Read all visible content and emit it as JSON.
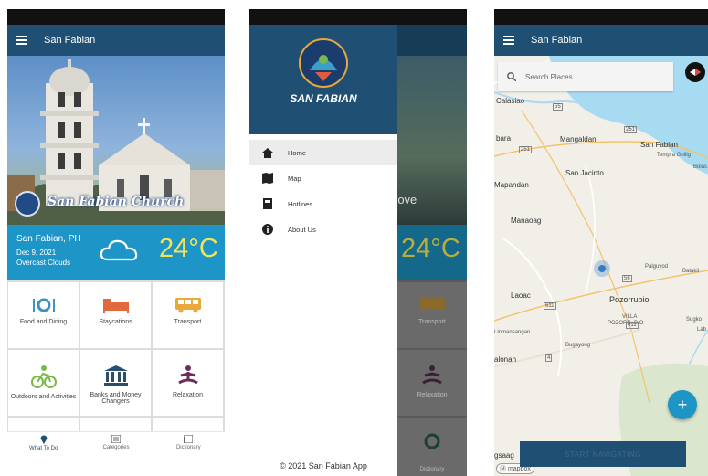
{
  "app": {
    "title": "San Fabian"
  },
  "home": {
    "hero_title": "San Fabian Church",
    "weather": {
      "location": "San Fabian, PH",
      "date": "Dec 9, 2021",
      "description": "Overcast Clouds",
      "temperature": "24°C"
    },
    "categories": [
      {
        "label": "Food and Dining",
        "icon": "food-icon",
        "color": "#3a93c4"
      },
      {
        "label": "Staycations",
        "icon": "bed-icon",
        "color": "#e0693d"
      },
      {
        "label": "Transport",
        "icon": "bus-icon",
        "color": "#e8a83a"
      },
      {
        "label": "Outdoors and Activities",
        "icon": "bike-icon",
        "color": "#7bb84a"
      },
      {
        "label": "Banks and Money Changers",
        "icon": "bank-icon",
        "color": "#2a4e6e"
      },
      {
        "label": "Relaxation",
        "icon": "yoga-icon",
        "color": "#6b2d5c"
      }
    ],
    "bottom_nav": [
      {
        "label": "What To Do",
        "icon": "location-pin-icon"
      },
      {
        "label": "Categories",
        "icon": "list-icon"
      },
      {
        "label": "Dictionary",
        "icon": "dictionary-icon"
      }
    ]
  },
  "drawer": {
    "brand": "SAN FABIAN",
    "menu": [
      {
        "label": "Home",
        "icon": "home-icon"
      },
      {
        "label": "Map",
        "icon": "map-icon"
      },
      {
        "label": "Hotlines",
        "icon": "hotline-icon"
      },
      {
        "label": "About Us",
        "icon": "info-icon"
      }
    ],
    "footer": "© 2021 San Fabian App",
    "background": {
      "hero_text": "rove",
      "temperature": "24°C",
      "tile_transport": "Transport",
      "tile_relaxation": "Relaxation",
      "nav_dictionary": "Dictionary"
    }
  },
  "map": {
    "search_placeholder": "Search Places",
    "labels": {
      "calasiao": "Calasiao",
      "bara": "bara",
      "mangaldan": "Mangaldan",
      "san_fabian": "San Fabian",
      "tempra_guiling": "Tempra Guilig",
      "bolas": "Bolas",
      "san_jacinto": "San Jacinto",
      "mapandan": "Mapandan",
      "manaoag": "Manaoag",
      "palguyod": "Palguyod",
      "batakil": "Batakil",
      "laoac": "Laoac",
      "pozorrubio": "Pozorrubio",
      "villa": "VILLA",
      "villa2": "POZORR..B.O",
      "sugcong": "Sugko",
      "lab": "Lab",
      "binmansangan": "Linmansangan",
      "bugayong": "Bugayong",
      "alonan": "alonan",
      "gsaag": "gsaag"
    },
    "roads": [
      "55",
      "251",
      "251",
      "56",
      "611",
      "611",
      "4"
    ],
    "start_button": "START NAVIGATING",
    "fab_label": "+",
    "attribution": "mapbox"
  }
}
